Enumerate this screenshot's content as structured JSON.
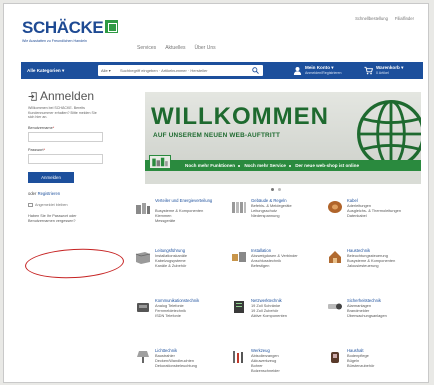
{
  "header": {
    "logo_text": "SCHÄCKE",
    "logo_tagline": "Wie Ausstatten zu Freundlichen Handeln",
    "top_nav": [
      "Services",
      "Aktuelles",
      "Über Uns"
    ],
    "util_links": [
      "Schnellbestellung",
      "Filialfinder"
    ]
  },
  "navbar": {
    "categories_label": "Alle Kategorien ▾",
    "search_scope": "Alle ▾",
    "search_placeholder": "Suchbegriff eingeben · Artikelnummer · Hersteller",
    "account_title": "Mein Konto ▾",
    "account_sub": "Anmelden/Registrieren",
    "cart_title": "Warenkorb ▾",
    "cart_sub": "0 Artikel",
    "color": "#1c4f9c"
  },
  "login": {
    "title": "Anmelden",
    "intro": "Willkommen bei SCHÄCKE. Bereits Kundennummer erhalten? Bitte melden Sie sich hier an.",
    "username_label": "Benutzername",
    "password_label": "Passwort",
    "button": "Anmelden",
    "register_prefix": "oder",
    "register_link": "Registrieren",
    "remember": "Angemeldet bleiben",
    "forgot": "Haben Sie Ihr Passwort oder Benutzernamen vergessen?"
  },
  "banner": {
    "title": "WILLKOMMEN",
    "subtitle": "AUF UNSEREM NEUEN WEB-AUFTRITT",
    "strip": [
      "Noch mehr Funktionen",
      "Noch mehr Service",
      "Der neue web-shop ist online"
    ],
    "accent": "#2a8a3e"
  },
  "carousel": {
    "count": 2,
    "active": 0
  },
  "categories": [
    {
      "title": "Verteiler und Energieverteilung",
      "items": [
        "Busysteme & Komponenten",
        "Klemmen",
        "Messgeräte"
      ],
      "icon": "distribution-panel-icon"
    },
    {
      "title": "Gebäude & Regeln",
      "items": [
        "Befehls- & Meldegeräte",
        "Leitungsschutz",
        "Niederspannung"
      ],
      "icon": "breaker-icon"
    },
    {
      "title": "Kabel",
      "items": [
        "Aderleitungen",
        "Ausgleichs- & Thermoleitungen",
        "Datenkabel"
      ],
      "icon": "cable-reel-icon"
    },
    {
      "title": "Leitungsführung",
      "items": [
        "Installationskanäle",
        "Kabelzugsysteme",
        "Kanäle & Zubehör"
      ],
      "icon": "cable-duct-icon"
    },
    {
      "title": "Installation",
      "items": [
        "Abzweigdosen & Verbinder",
        "Anschlusstechnik",
        "Befestigen"
      ],
      "icon": "installation-icon"
    },
    {
      "title": "Haustechnik",
      "items": [
        "Beleuchtungssteuerung",
        "Busysteme & Komponenten",
        "Jalousiesteuerung"
      ],
      "icon": "house-icon"
    },
    {
      "title": "Kommunikationstechnik",
      "items": [
        "Analog Telefonie",
        "Fernmeldetechnik",
        "ISDN Telefonie"
      ],
      "icon": "phone-icon"
    },
    {
      "title": "Netzwerktechnik",
      "items": [
        "19 Zoll Schränke",
        "19 Zoll Zubehör",
        "Aktive Komponenten"
      ],
      "icon": "network-icon"
    },
    {
      "title": "Sicherheitstechnik",
      "items": [
        "Alarmanlagen",
        "Brandmelder",
        "Überwachungsanlagen"
      ],
      "icon": "security-icon"
    },
    {
      "title": "Lichttechnik",
      "items": [
        "Baustrahler",
        "Decken/Wandleuchten",
        "Dekorationsbeleuchtung"
      ],
      "icon": "lamp-icon"
    },
    {
      "title": "Werkzeug",
      "items": [
        "Abisolierzangen",
        "Akkuwerkzeug",
        "Bohrer",
        "Bolzenschneider"
      ],
      "icon": "tool-icon"
    },
    {
      "title": "Haushalt",
      "items": [
        "Bodenpflege",
        "Bügeln",
        "Bürstenzubehör"
      ],
      "icon": "household-icon"
    }
  ],
  "annotation_color": "#c62323"
}
